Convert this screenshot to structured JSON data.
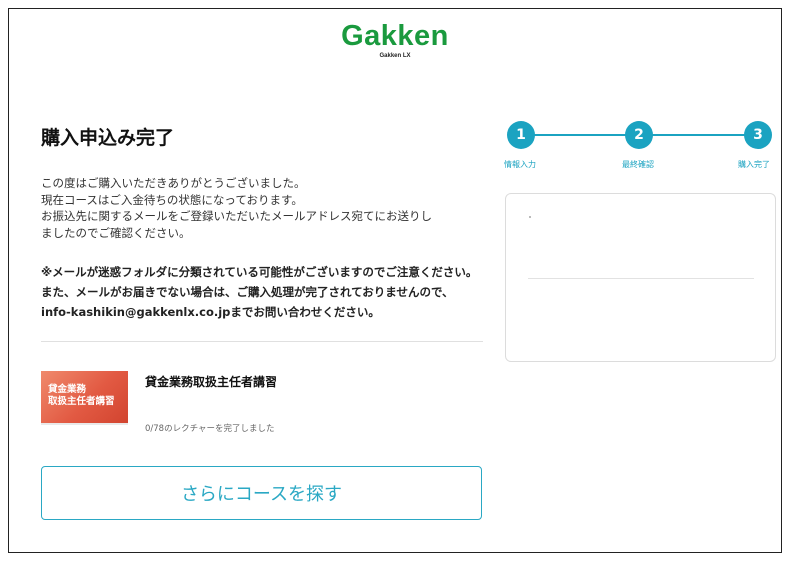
{
  "logo": {
    "brand": "Gakken",
    "sub": "Gakken LX",
    "color": "#1a9a3e"
  },
  "page": {
    "title": "購入申込み完了",
    "message_lines": [
      "この度はご購入いただきありがとうございました。",
      "現在コースはご入金待ちの状態になっております。",
      "お振込先に関するメールをご登録いただいたメールアドレス宛てにお送りし",
      "ましたのでご確認ください。"
    ],
    "notice": "※メールが迷惑フォルダに分類されている可能性がございますのでご注意ください。また、メールがお届きでない場合は、ご購入処理が完了されておりませんので、info-kashikin@gakkenlx.co.jpまでお問い合わせください。"
  },
  "course": {
    "thumbnail_lines": [
      "貸金業務",
      "取扱主任者講習"
    ],
    "title": "貸金業務取扱主任者講習",
    "progress": "0/78のレクチャーを完了しました"
  },
  "buttons": {
    "more_courses": "さらにコースを探す"
  },
  "stepper": {
    "accent": "#1ba3c1",
    "steps": [
      {
        "number": "1",
        "label": "情報入力"
      },
      {
        "number": "2",
        "label": "最終確認"
      },
      {
        "number": "3",
        "label": "購入完了"
      }
    ]
  }
}
